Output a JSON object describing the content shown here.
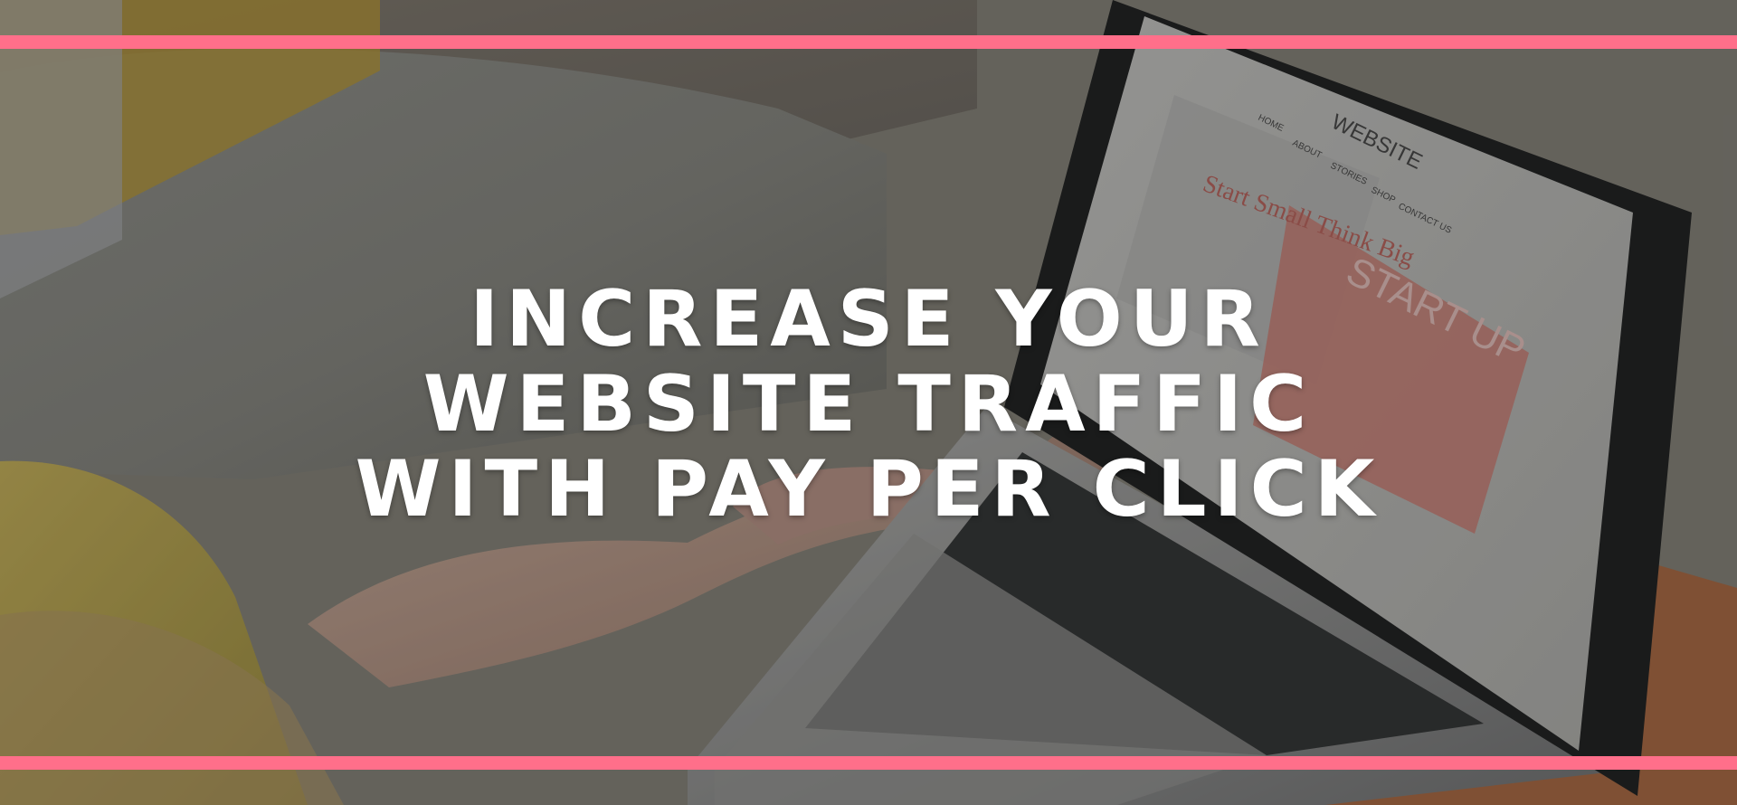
{
  "hero": {
    "headline_lines": [
      "INCREASE YOUR",
      "WEBSITE TRAFFIC",
      "WITH PAY PER CLICK"
    ]
  },
  "laptop_screen": {
    "site_title": "WEBSITE",
    "nav": [
      "HOME",
      "ABOUT",
      "STORIES",
      "SHOP",
      "CONTACT US"
    ],
    "logo_script": "Start Small Think Big",
    "panel_title": "START UP"
  },
  "colors": {
    "accent": "#ff6f8a",
    "overlay": "rgba(18,18,18,0.34)",
    "headline": "#ffffff"
  }
}
